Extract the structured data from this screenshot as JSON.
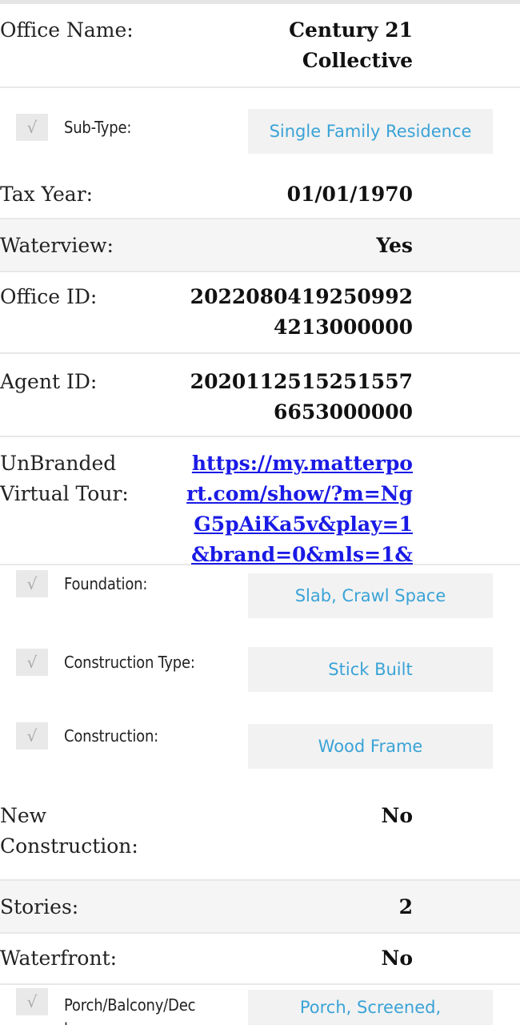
{
  "details": {
    "office_name": {
      "label": "Office Name:",
      "value_line1": "Century 21",
      "value_line2": "Collective"
    },
    "sub_type": {
      "check_icon": "√",
      "label": "Sub-Type:",
      "value": "Single Family Residence"
    },
    "tax_year": {
      "label": "Tax Year:",
      "value": "01/01/1970"
    },
    "waterview": {
      "label": "Waterview:",
      "value": "Yes"
    },
    "office_id": {
      "label": "Office ID:",
      "value_line1": "2022080419250992",
      "value_line2": "4213000000"
    },
    "agent_id": {
      "label": "Agent ID:",
      "value_line1": "2020112515251557",
      "value_line2": "6653000000"
    },
    "virtual_tour": {
      "label_line1": "UnBranded",
      "label_line2": "Virtual Tour:",
      "url_line1": "https://my.matterpo",
      "url_line2": "rt.com/show/?m=Ng",
      "url_line3": "G5pAiKa5v&play=1",
      "url_line4": "&brand=0&mls=1&"
    },
    "foundation": {
      "check_icon": "√",
      "label": "Foundation:",
      "value": "Slab, Crawl Space"
    },
    "construction_type": {
      "check_icon": "√",
      "label": "Construction Type:",
      "value": "Stick Built"
    },
    "construction": {
      "check_icon": "√",
      "label": "Construction:",
      "value": "Wood Frame"
    },
    "new_construction": {
      "label_line1": "New",
      "label_line2": "Construction:",
      "value": "No"
    },
    "stories": {
      "label": "Stories:",
      "value": "2"
    },
    "waterfront": {
      "label": "Waterfront:",
      "value": "No"
    },
    "porch": {
      "check_icon": "√",
      "label_line1": "Porch/Balcony/Dec",
      "label_line2": "k:",
      "value": "Porch, Screened,"
    }
  },
  "colors": {
    "link": "#1a1ae6",
    "chip_text": "#3aa3d7",
    "chip_bg": "#f2f2f2",
    "shaded_row": "#f5f5f5",
    "divider": "#e8e8e8"
  }
}
